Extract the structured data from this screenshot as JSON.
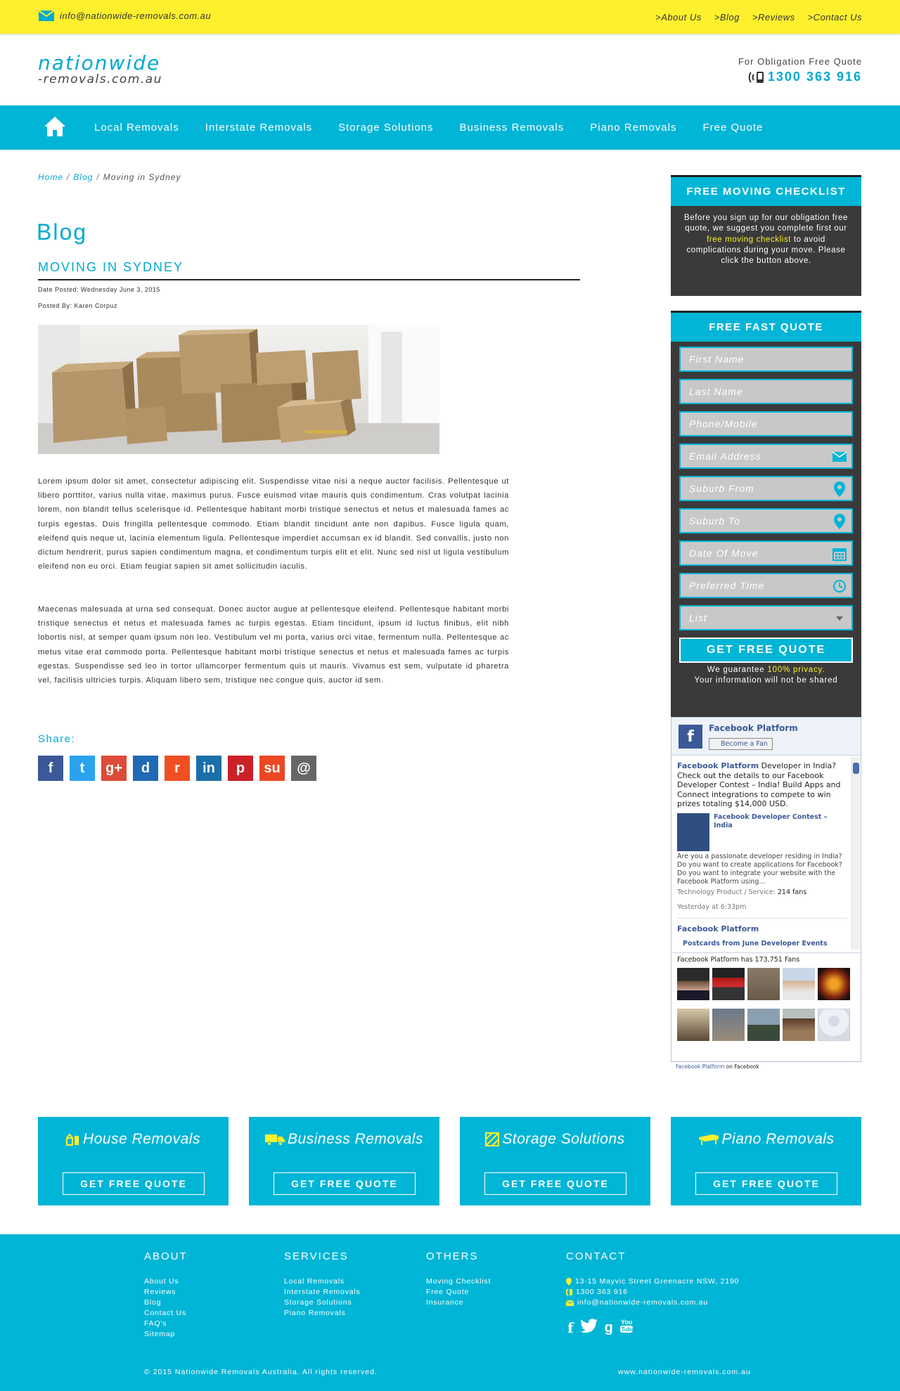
{
  "colors": {
    "accent": "#00b5d6",
    "highlight": "#fff02e",
    "dark_panel": "#3a3a3a"
  },
  "topbar": {
    "email": "info@nationwide-removals.com.au",
    "links": [
      ">About Us",
      ">Blog",
      ">Reviews",
      ">Contact Us"
    ]
  },
  "header": {
    "logo_line1": "nationwide",
    "logo_line2": "-removals.com.au",
    "quote_label": "For Obligation Free Quote",
    "phone": "1300 363 916"
  },
  "nav": {
    "items": [
      "Local Removals",
      "Interstate Removals",
      "Storage Solutions",
      "Business Removals",
      "Piano Removals",
      "Free Quote"
    ]
  },
  "breadcrumb": {
    "home": "Home",
    "sep": "/",
    "blog": "Blog",
    "current": "Moving in Sydney"
  },
  "post": {
    "page_title": "Blog",
    "title": "MOVING IN SYDNEY",
    "date": "Date Posted: Wednesday June 3, 2015",
    "author": "Posted By: Karen Corpuz",
    "para1": "Lorem ipsum dolor sit amet, consectetur adipiscing elit. Suspendisse vitae nisi a neque auctor facilisis. Pellentesque ut libero porttitor, varius nulla vitae, maximus purus. Fusce euismod vitae mauris quis condimentum. Cras volutpat lacinia lorem, non blandit tellus scelerisque id. Pellentesque habitant morbi tristique senectus et netus et malesuada fames ac turpis egestas. Duis fringilla pellentesque commodo. Etiam blandit tincidunt ante non dapibus. Fusce ligula quam, eleifend quis neque ut, lacinia elementum ligula.  Pellentesque imperdiet accumsan ex id blandit. Sed convallis, justo non dictum hendrerit, purus sapien condimentum magna, et condimentum turpis elit et elit. Nunc sed nisl ut ligula vestibulum eleifend non eu orci. Etiam feugiat sapien sit amet sollicitudin iaculis.",
    "para2": "Maecenas malesuada at urna sed consequat. Donec auctor augue at pellentesque eleifend. Pellentesque habitant morbi tristique senectus et netus et malesuada fames ac turpis egestas. Etiam tincidunt, ipsum id luctus finibus, elit nibh lobortis nisl, at semper quam ipsum non leo. Vestibulum vel mi porta, varius orci vitae, fermentum nulla. Pellentesque ac metus vitae erat commodo porta. Pellentesque habitant morbi tristique senectus et netus et malesuada fames ac turpis egestas. Suspendisse sed leo in tortor ullamcorper fermentum quis ut mauris. Vivamus est sem, vulputate id pharetra vel, facilisis ultricies turpis. Aliquam libero sem, tristique nec congue quis, auctor id sem.",
    "share_label": "Share:"
  },
  "share": [
    {
      "name": "facebook",
      "glyph": "f",
      "color": "#3b5998"
    },
    {
      "name": "twitter",
      "glyph": "t",
      "color": "#2aa3ef"
    },
    {
      "name": "google-plus",
      "glyph": "g+",
      "color": "#dd4b39"
    },
    {
      "name": "delicious",
      "glyph": "d",
      "color": "#1f6ab5"
    },
    {
      "name": "reddit",
      "glyph": "r",
      "color": "#f04f23"
    },
    {
      "name": "linkedin",
      "glyph": "in",
      "color": "#1a6fa9"
    },
    {
      "name": "pinterest",
      "glyph": "p",
      "color": "#cb2027"
    },
    {
      "name": "stumbleupon",
      "glyph": "su",
      "color": "#eb4823"
    },
    {
      "name": "email",
      "glyph": "@",
      "color": "#666666"
    }
  ],
  "checklist": {
    "title": "FREE MOVING CHECKLIST",
    "text_a": "Before you sign up for our obligation free quote, we suggest you complete first our ",
    "link": "free moving checklist",
    "text_b": " to avoid complications during your move. Please click the button above."
  },
  "quote_form": {
    "title": "FREE FAST QUOTE",
    "placeholders": [
      "First Name",
      "Last Name",
      "Phone/Mobile",
      "Email Address",
      "Suburb From",
      "Suburb To",
      "Date Of Move",
      "Preferred Time",
      "List"
    ],
    "icons": [
      "",
      "",
      "",
      "mail-icon",
      "map-pin-icon",
      "map-pin-icon",
      "calendar-icon",
      "clock-icon",
      "dropdown-arrow-icon"
    ],
    "submit": "GET FREE QUOTE",
    "guarantee_a": "We guarantee ",
    "guarantee_hl": "100% privacy.",
    "guarantee_b": "Your information will not be shared"
  },
  "facebook": {
    "page_name": "Facebook Platform",
    "fan_button": "Become a Fan",
    "post1_author": "Facebook Platform",
    "post1_text": " Developer in India? Check out the details to our Facebook Developer Contest – India! Build Apps and Connect integrations to compete to win prizes totaling $14,000 USD.",
    "post1_link_title": "Facebook Developer Contest – India",
    "post1_link_desc": "Are you a passionate developer residing in India? Do you want to create applications for Facebook? Do you want to integrate your website with the Facebook Platform using...",
    "post1_meta_a": "Technology Product / Service: ",
    "post1_meta_b": "214 fans",
    "post1_time": "Yesterday at 6:33pm",
    "post2_author": "Facebook Platform",
    "post2_link_title": "Postcards from June Developer Events",
    "fans_text": "Facebook Platform has 173,751 Fans",
    "footer_a": "Facebook Platform",
    "footer_b": " on Facebook"
  },
  "services": [
    {
      "title": "House Removals",
      "button": "GET FREE QUOTE",
      "icon": "house-icon"
    },
    {
      "title": "Business Removals",
      "button": "GET FREE QUOTE",
      "icon": "truck-icon"
    },
    {
      "title": "Storage Solutions",
      "button": "GET FREE QUOTE",
      "icon": "storage-icon"
    },
    {
      "title": "Piano Removals",
      "button": "GET FREE QUOTE",
      "icon": "piano-icon"
    }
  ],
  "footer": {
    "about": {
      "heading": "ABOUT",
      "links": [
        "About Us",
        "Reviews",
        "Blog",
        "Contact Us",
        "FAQ's",
        "Sitemap"
      ]
    },
    "services": {
      "heading": "SERVICES",
      "links": [
        "Local Removals",
        "Interstate Removals",
        "Storage Solutions",
        "Piano Removals"
      ]
    },
    "others": {
      "heading": "OTHERS",
      "links": [
        "Moving Checklist",
        "Free Quote",
        "Insurance"
      ]
    },
    "contact": {
      "heading": "CONTACT",
      "address": "13-15 Mayvic Street Greenacre NSW, 2190",
      "phone": "1300 363 916",
      "email": "info@nationwide-removals.com.au"
    },
    "social": [
      "facebook-icon",
      "twitter-icon",
      "google-plus-icon",
      "youtube-icon"
    ],
    "copyright": "© 2015 Nationwide Removals Australia. All rights reserved.",
    "site": "www.nationwide-removals.com.au"
  }
}
